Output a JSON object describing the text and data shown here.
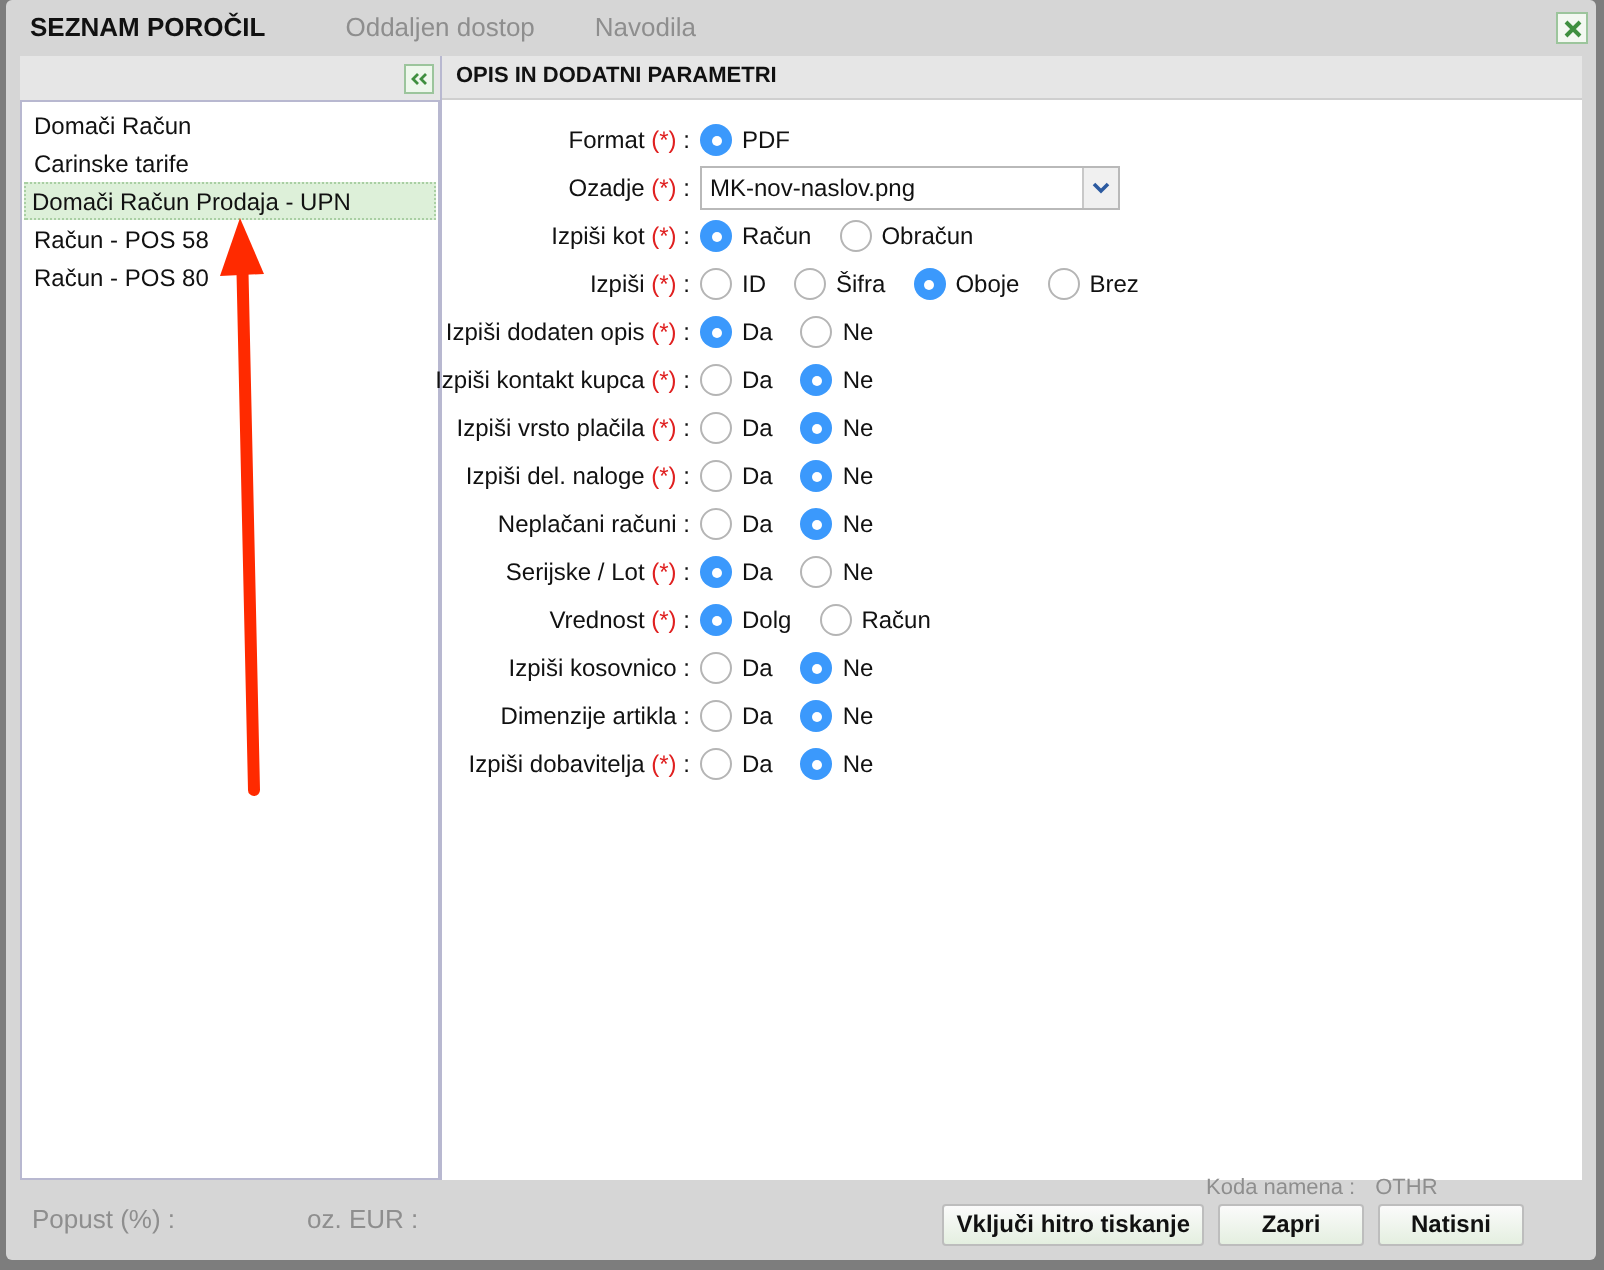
{
  "window": {
    "title": "SEZNAM POROČIL"
  },
  "background_texts": {
    "top": [
      "Oddaljen dostop",
      "Navodila"
    ],
    "bottom": [
      "Popust (%) :",
      "oz. EUR :"
    ],
    "right": [
      "Koda namena :",
      "OTHR"
    ]
  },
  "report_list": {
    "items": [
      {
        "label": "Domači Račun",
        "selected": false
      },
      {
        "label": "Carinske tarife",
        "selected": false
      },
      {
        "label": "Domači Račun Prodaja - UPN",
        "selected": true
      },
      {
        "label": "Račun - POS 58",
        "selected": false
      },
      {
        "label": "Račun - POS 80",
        "selected": false
      }
    ]
  },
  "parameters": {
    "title": "OPIS IN DODATNI PARAMETRI",
    "required_mark": "(*)",
    "separator": ":",
    "rows": [
      {
        "label": "Format",
        "required": true,
        "kind": "radio",
        "options": [
          {
            "label": "PDF",
            "selected": true
          }
        ]
      },
      {
        "label": "Ozadje",
        "required": true,
        "kind": "select",
        "value": "MK-nov-naslov.png"
      },
      {
        "label": "Izpiši kot",
        "required": true,
        "kind": "radio",
        "options": [
          {
            "label": "Račun",
            "selected": true
          },
          {
            "label": "Obračun",
            "selected": false
          }
        ]
      },
      {
        "label": "Izpiši",
        "required": true,
        "kind": "radio",
        "options": [
          {
            "label": "ID",
            "selected": false
          },
          {
            "label": "Šifra",
            "selected": false
          },
          {
            "label": "Oboje",
            "selected": true
          },
          {
            "label": "Brez",
            "selected": false
          }
        ]
      },
      {
        "label": "Izpiši dodaten opis",
        "required": true,
        "kind": "radio",
        "options": [
          {
            "label": "Da",
            "selected": true
          },
          {
            "label": "Ne",
            "selected": false
          }
        ]
      },
      {
        "label": "Izpiši kontakt kupca",
        "required": true,
        "kind": "radio",
        "options": [
          {
            "label": "Da",
            "selected": false
          },
          {
            "label": "Ne",
            "selected": true
          }
        ]
      },
      {
        "label": "Izpiši vrsto plačila",
        "required": true,
        "kind": "radio",
        "options": [
          {
            "label": "Da",
            "selected": false
          },
          {
            "label": "Ne",
            "selected": true
          }
        ]
      },
      {
        "label": "Izpiši del. naloge",
        "required": true,
        "kind": "radio",
        "options": [
          {
            "label": "Da",
            "selected": false
          },
          {
            "label": "Ne",
            "selected": true
          }
        ]
      },
      {
        "label": "Neplačani računi",
        "required": false,
        "kind": "radio",
        "options": [
          {
            "label": "Da",
            "selected": false
          },
          {
            "label": "Ne",
            "selected": true
          }
        ]
      },
      {
        "label": "Serijske / Lot",
        "required": true,
        "kind": "radio",
        "options": [
          {
            "label": "Da",
            "selected": true
          },
          {
            "label": "Ne",
            "selected": false
          }
        ]
      },
      {
        "label": "Vrednost",
        "required": true,
        "kind": "radio",
        "options": [
          {
            "label": "Dolg",
            "selected": true
          },
          {
            "label": "Račun",
            "selected": false
          }
        ]
      },
      {
        "label": "Izpiši kosovnico",
        "required": false,
        "kind": "radio",
        "options": [
          {
            "label": "Da",
            "selected": false
          },
          {
            "label": "Ne",
            "selected": true
          }
        ]
      },
      {
        "label": "Dimenzije artikla",
        "required": false,
        "kind": "radio",
        "options": [
          {
            "label": "Da",
            "selected": false
          },
          {
            "label": "Ne",
            "selected": true
          }
        ]
      },
      {
        "label": "Izpiši dobavitelja",
        "required": true,
        "kind": "radio",
        "options": [
          {
            "label": "Da",
            "selected": false
          },
          {
            "label": "Ne",
            "selected": true
          }
        ]
      }
    ]
  },
  "buttons": [
    "Vključi hitro tiskanje",
    "Zapri",
    "Natisni"
  ]
}
